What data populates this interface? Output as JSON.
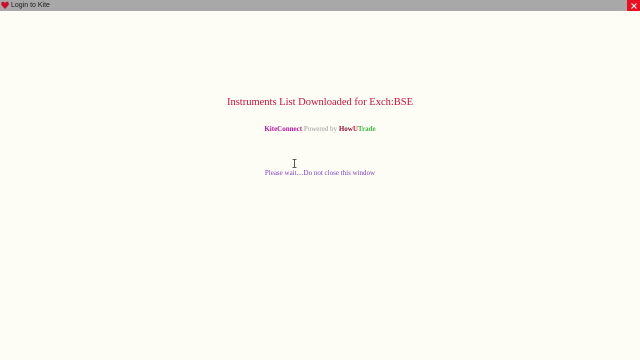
{
  "window": {
    "title": "Login to Kite",
    "icon": "heart-icon",
    "close_icon": "close-icon"
  },
  "content": {
    "heading": "Instruments List Downloaded for Exch:BSE",
    "powered": {
      "brand": "KiteConnect",
      "middle": " Powered by ",
      "how": "How",
      "u": "U",
      "trade": "Trade"
    },
    "wait_message": "Please wait....Do not close this window"
  },
  "colors": {
    "heading": "#c0143c",
    "brand": "#b5179e",
    "powered_by": "#9a9a9a",
    "how": "#8a1538",
    "u": "#e01030",
    "trade": "#3cb83c",
    "wait": "#7b3fbf",
    "window_bg": "#fdfdf6",
    "titlebar": "#a8a8a8",
    "close": "#e81123"
  }
}
